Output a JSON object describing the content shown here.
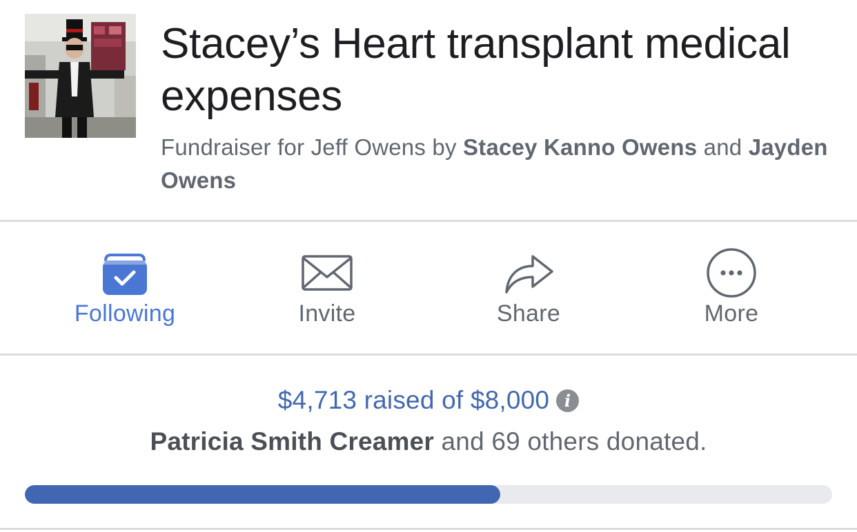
{
  "fundraiser": {
    "title": "Stacey’s Heart transplant medical expenses",
    "byline_prefix": "Fundraiser for Jeff Owens by",
    "organizer_1": "Stacey Kanno Owens",
    "byline_joiner": "and",
    "organizer_2": "Jayden Owens"
  },
  "actions": [
    {
      "label": "Following",
      "icon": "following-check-icon",
      "active": true
    },
    {
      "label": "Invite",
      "icon": "envelope-icon"
    },
    {
      "label": "Share",
      "icon": "share-arrow-icon"
    },
    {
      "label": "More",
      "icon": "more-dots-icon"
    }
  ],
  "progress": {
    "raised_text": "$4,713 raised of $8,000",
    "raised_amount": 4713,
    "goal_amount": 8000,
    "fraction": 0.589,
    "top_donor": "Patricia Smith Creamer",
    "donors_suffix": "and 69 others donated."
  },
  "colors": {
    "accent": "#4a77d4",
    "progress": "#4267b2",
    "track": "#e9eaed",
    "muted_text": "#606770",
    "divider": "#dadde1"
  }
}
